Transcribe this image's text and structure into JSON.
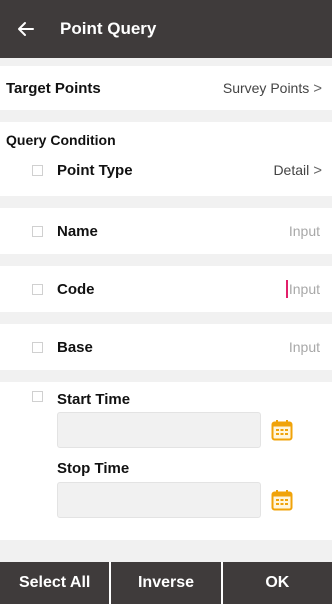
{
  "header": {
    "title": "Point Query",
    "back_icon": "arrow-left-icon"
  },
  "target_points": {
    "label": "Target Points",
    "value": "Survey Points"
  },
  "query_condition": {
    "label": "Query Condition"
  },
  "point_type": {
    "label": "Point Type",
    "value": "Detail"
  },
  "name": {
    "label": "Name",
    "placeholder": "Input"
  },
  "code": {
    "label": "Code",
    "placeholder": "Input"
  },
  "base": {
    "label": "Base",
    "placeholder": "Input"
  },
  "start_time": {
    "label": "Start Time"
  },
  "stop_time": {
    "label": "Stop Time"
  },
  "buttons": {
    "select_all": "Select All",
    "inverse": "Inverse",
    "ok": "OK"
  },
  "colors": {
    "header_bg": "#3f3b3b",
    "accent_calendar": "#f0a30a",
    "cursor": "#e21f6a"
  }
}
